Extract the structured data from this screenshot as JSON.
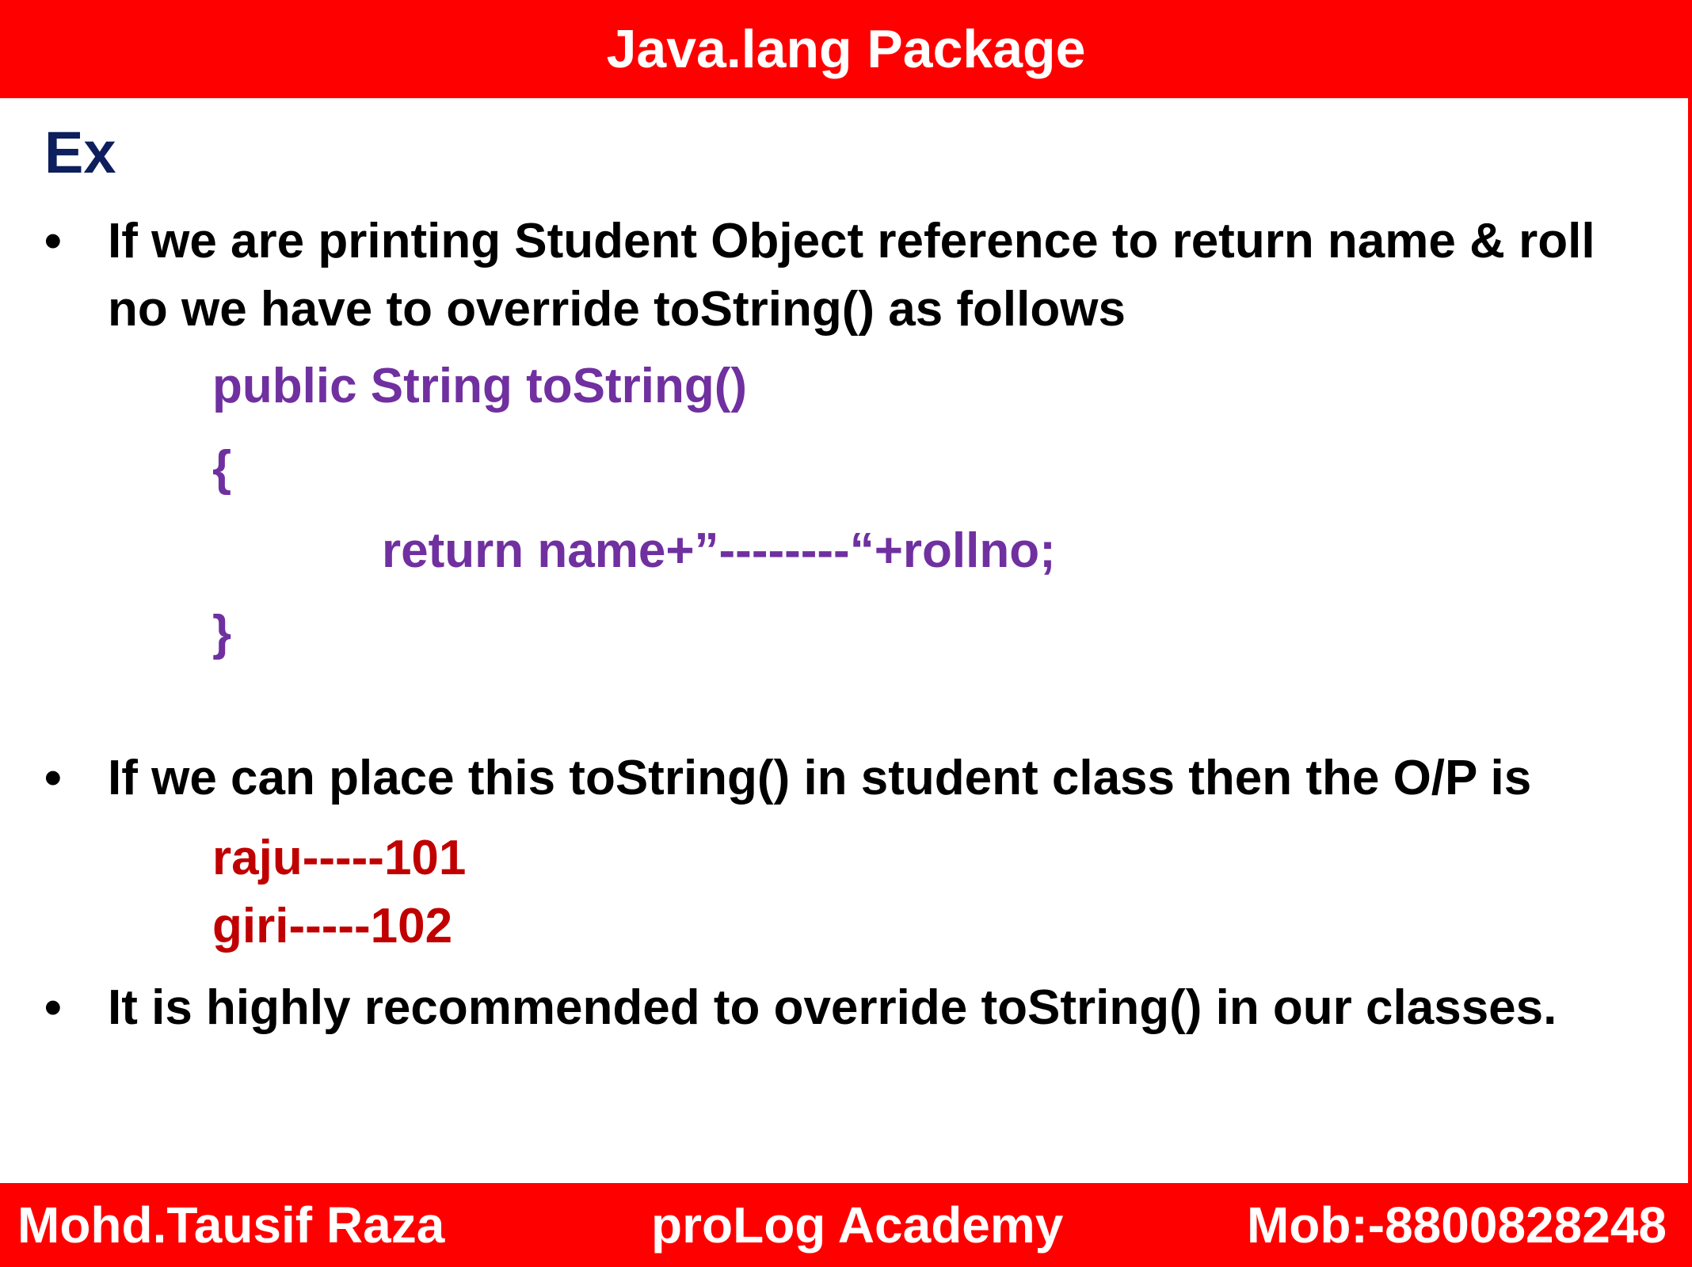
{
  "header": {
    "title": "Java.lang Package"
  },
  "content": {
    "heading": "Ex",
    "bullet_symbol": "•",
    "bullet1": "If we are printing Student Object reference to return name & roll no we have to override toString() as follows",
    "code": {
      "line1": "public String toString()",
      "line2": "{",
      "line3": "return name+”--------“+rollno;",
      "line4": "}"
    },
    "bullet2": "If we can place this toString() in student class then the O/P is",
    "output": {
      "line1": "raju-----101",
      "line2": "giri-----102"
    },
    "bullet3": "It is highly recommended to override toString() in our classes."
  },
  "footer": {
    "left": "Mohd.Tausif Raza",
    "center": "proLog Academy",
    "right": "Mob:-8800828248"
  },
  "colors": {
    "banner": "#ff0000",
    "heading": "#0d1f5c",
    "code": "#7030a0",
    "output": "#c00000"
  }
}
